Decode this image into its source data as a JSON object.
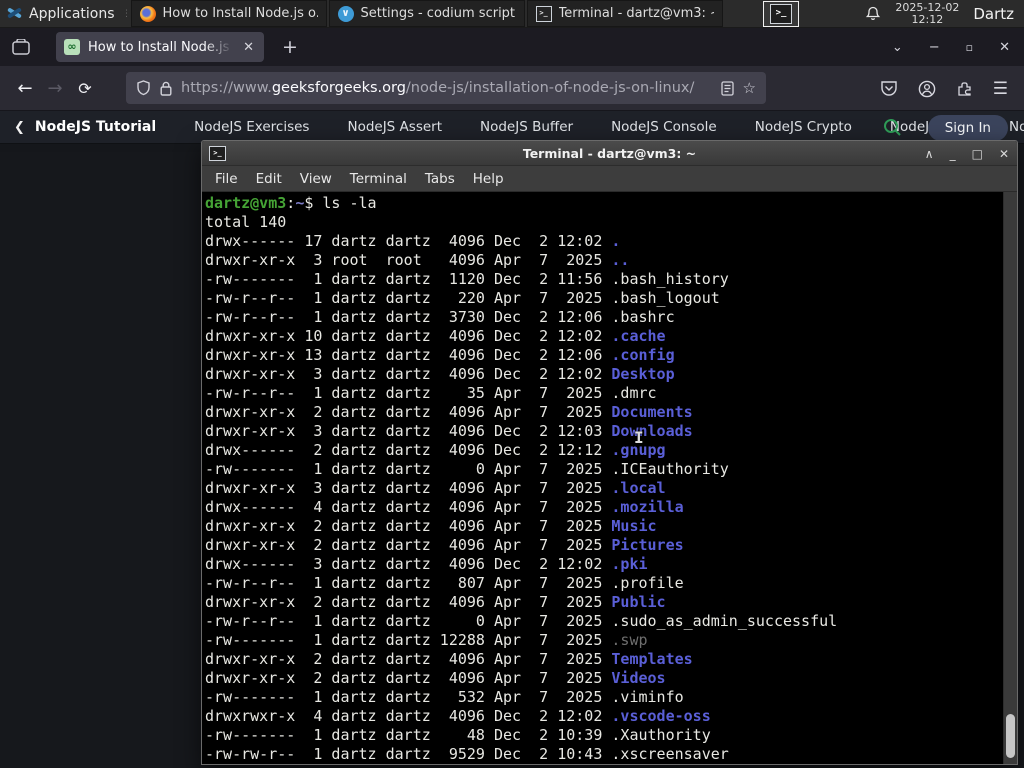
{
  "panel": {
    "applications_label": "Applications",
    "windows": [
      {
        "title": "How to Install Node.js o...",
        "icon": "firefox"
      },
      {
        "title": "Settings - codium script...",
        "icon": "codium"
      },
      {
        "title": "Terminal - dartz@vm3: ~",
        "icon": "terminal"
      }
    ],
    "clock_date": "2025-12-02",
    "clock_time": "12:12",
    "user": "Dartz"
  },
  "browser": {
    "tab_title": "How to Install Node.js on",
    "url_scheme": "https://www.",
    "url_domain": "geeksforgeeks.org",
    "url_path": "/node-js/installation-of-node-js-on-linux/"
  },
  "site_nav": {
    "items": [
      {
        "label": "NodeJS Tutorial",
        "cls": "active"
      },
      {
        "label": "NodeJS Exercises"
      },
      {
        "label": "NodeJS Assert"
      },
      {
        "label": "NodeJS Buffer"
      },
      {
        "label": "NodeJS Console"
      },
      {
        "label": "NodeJS Crypto"
      },
      {
        "label": "NodeJS DNS"
      },
      {
        "label": "Node",
        "cls": "cut"
      }
    ],
    "sign_in_label": "Sign In"
  },
  "terminal": {
    "title": "Terminal - dartz@vm3: ~",
    "menu": [
      "File",
      "Edit",
      "View",
      "Terminal",
      "Tabs",
      "Help"
    ],
    "prompt_user": "dartz@vm3",
    "prompt_sep": ":",
    "prompt_path": "~",
    "prompt_cmd": "$ ls -la",
    "total_line": "total 140",
    "listing": [
      {
        "pre": "drwx------ 17 dartz dartz  4096 Dec  2 12:02 ",
        "name": ".",
        "cls": "dir"
      },
      {
        "pre": "drwxr-xr-x  3 root  root   4096 Apr  7  2025 ",
        "name": "..",
        "cls": "dir"
      },
      {
        "pre": "-rw-------  1 dartz dartz  1120 Dec  2 11:56 ",
        "name": ".bash_history",
        "cls": "plain"
      },
      {
        "pre": "-rw-r--r--  1 dartz dartz   220 Apr  7  2025 ",
        "name": ".bash_logout",
        "cls": "plain"
      },
      {
        "pre": "-rw-r--r--  1 dartz dartz  3730 Dec  2 12:06 ",
        "name": ".bashrc",
        "cls": "plain"
      },
      {
        "pre": "drwxr-xr-x 10 dartz dartz  4096 Dec  2 12:02 ",
        "name": ".cache",
        "cls": "dir"
      },
      {
        "pre": "drwxr-xr-x 13 dartz dartz  4096 Dec  2 12:06 ",
        "name": ".config",
        "cls": "dir"
      },
      {
        "pre": "drwxr-xr-x  3 dartz dartz  4096 Dec  2 12:02 ",
        "name": "Desktop",
        "cls": "dir"
      },
      {
        "pre": "-rw-r--r--  1 dartz dartz    35 Apr  7  2025 ",
        "name": ".dmrc",
        "cls": "plain"
      },
      {
        "pre": "drwxr-xr-x  2 dartz dartz  4096 Apr  7  2025 ",
        "name": "Documents",
        "cls": "dir"
      },
      {
        "pre": "drwxr-xr-x  3 dartz dartz  4096 Dec  2 12:03 ",
        "name": "Downloads",
        "cls": "dir"
      },
      {
        "pre": "drwx------  2 dartz dartz  4096 Dec  2 12:12 ",
        "name": ".gnupg",
        "cls": "dir"
      },
      {
        "pre": "-rw-------  1 dartz dartz     0 Apr  7  2025 ",
        "name": ".ICEauthority",
        "cls": "plain"
      },
      {
        "pre": "drwxr-xr-x  3 dartz dartz  4096 Apr  7  2025 ",
        "name": ".local",
        "cls": "dir"
      },
      {
        "pre": "drwx------  4 dartz dartz  4096 Apr  7  2025 ",
        "name": ".mozilla",
        "cls": "dir"
      },
      {
        "pre": "drwxr-xr-x  2 dartz dartz  4096 Apr  7  2025 ",
        "name": "Music",
        "cls": "dir"
      },
      {
        "pre": "drwxr-xr-x  2 dartz dartz  4096 Apr  7  2025 ",
        "name": "Pictures",
        "cls": "dir"
      },
      {
        "pre": "drwx------  3 dartz dartz  4096 Dec  2 12:02 ",
        "name": ".pki",
        "cls": "dir"
      },
      {
        "pre": "-rw-r--r--  1 dartz dartz   807 Apr  7  2025 ",
        "name": ".profile",
        "cls": "plain"
      },
      {
        "pre": "drwxr-xr-x  2 dartz dartz  4096 Apr  7  2025 ",
        "name": "Public",
        "cls": "dir"
      },
      {
        "pre": "-rw-r--r--  1 dartz dartz     0 Apr  7  2025 ",
        "name": ".sudo_as_admin_successful",
        "cls": "plain"
      },
      {
        "pre": "-rw-------  1 dartz dartz 12288 Apr  7  2025 ",
        "name": ".swp",
        "cls": "dim"
      },
      {
        "pre": "drwxr-xr-x  2 dartz dartz  4096 Apr  7  2025 ",
        "name": "Templates",
        "cls": "dir"
      },
      {
        "pre": "drwxr-xr-x  2 dartz dartz  4096 Apr  7  2025 ",
        "name": "Videos",
        "cls": "dir"
      },
      {
        "pre": "-rw-------  1 dartz dartz   532 Apr  7  2025 ",
        "name": ".viminfo",
        "cls": "plain"
      },
      {
        "pre": "drwxrwxr-x  4 dartz dartz  4096 Dec  2 12:02 ",
        "name": ".vscode-oss",
        "cls": "dir"
      },
      {
        "pre": "-rw-------  1 dartz dartz    48 Dec  2 10:39 ",
        "name": ".Xauthority",
        "cls": "plain"
      },
      {
        "pre": "-rw-rw-r--  1 dartz dartz  9529 Dec  2 10:43 ",
        "name": ".xscreensaver",
        "cls": "plain"
      }
    ]
  },
  "colors": {
    "prompt_green": "#45a335",
    "prompt_path_blue": "#7d7dc8",
    "dir_blue": "#5a5fd7",
    "terminal_bg": "#000000",
    "panel_bg": "#2b2b2b",
    "firefox_toolbar": "#2b2a33",
    "gfg_search_green": "#2f9d58"
  }
}
